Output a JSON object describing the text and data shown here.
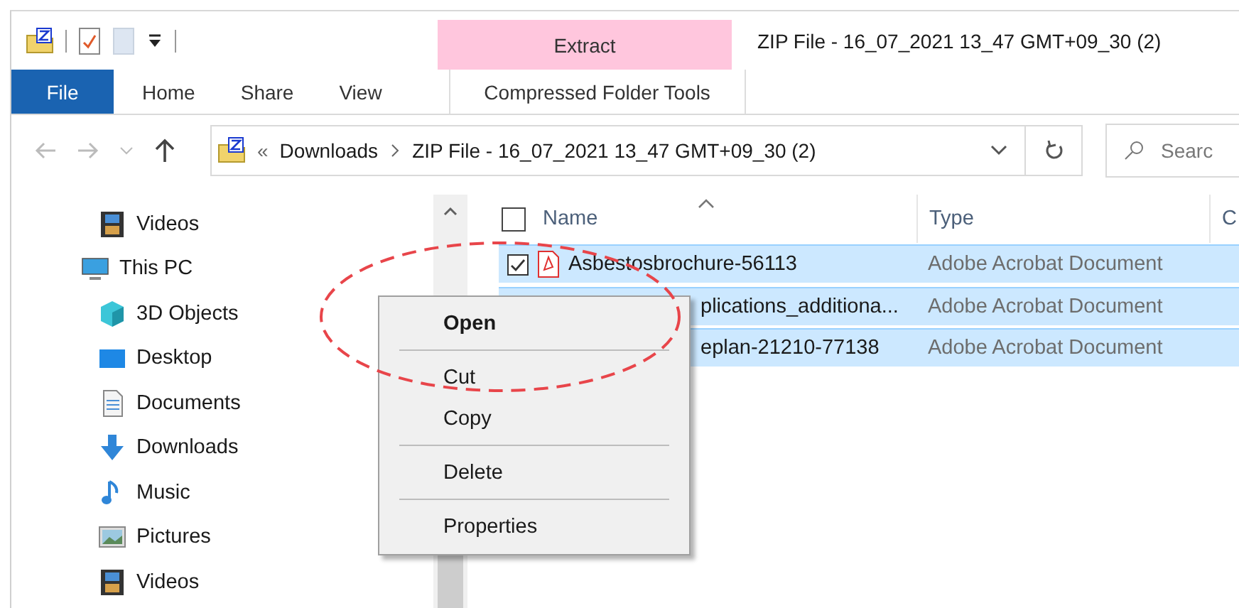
{
  "window": {
    "title": "ZIP File - 16_07_2021 13_47 GMT+09_30 (2)"
  },
  "ribbon": {
    "context_group": "Extract",
    "tabs": [
      {
        "label": "File",
        "kind": "file",
        "selected": false
      },
      {
        "label": "Home",
        "kind": "plain",
        "selected": false
      },
      {
        "label": "Share",
        "kind": "plain",
        "selected": false
      },
      {
        "label": "View",
        "kind": "plain",
        "selected": false
      },
      {
        "label": "Compressed Folder Tools",
        "kind": "contextual",
        "selected": false
      }
    ]
  },
  "address": {
    "overflow": "«",
    "crumbs": [
      "Downloads",
      "ZIP File - 16_07_2021 13_47 GMT+09_30 (2)"
    ]
  },
  "search": {
    "placeholder": "Searc"
  },
  "nav": {
    "items": [
      {
        "label": "Videos",
        "kind": "videos"
      },
      {
        "label": "This PC",
        "kind": "pc",
        "children": [
          {
            "label": "3D Objects",
            "kind": "objects"
          },
          {
            "label": "Desktop",
            "kind": "desktop"
          },
          {
            "label": "Documents",
            "kind": "documents"
          },
          {
            "label": "Downloads",
            "kind": "downloads"
          },
          {
            "label": "Music",
            "kind": "music"
          },
          {
            "label": "Pictures",
            "kind": "pictures"
          },
          {
            "label": "Videos",
            "kind": "videos"
          }
        ]
      }
    ]
  },
  "file_list": {
    "columns": [
      "Name",
      "Type",
      "C"
    ],
    "all_checked": false,
    "rows": [
      {
        "name": "Asbestosbrochure-56113",
        "type": "Adobe Acrobat Document",
        "selected": true,
        "checked": true,
        "covered": false
      },
      {
        "name": "plications_additiona...",
        "type": "Adobe Acrobat Document",
        "selected": true,
        "covered": true
      },
      {
        "name": "eplan-21210-77138",
        "type": "Adobe Acrobat Document",
        "selected": true,
        "covered": true
      }
    ]
  },
  "context_menu": {
    "items": [
      {
        "kind": "item",
        "label": "Open",
        "default": true
      },
      {
        "kind": "separator"
      },
      {
        "kind": "item",
        "label": "Cut",
        "default": false
      },
      {
        "kind": "item",
        "label": "Copy",
        "default": false
      },
      {
        "kind": "separator"
      },
      {
        "kind": "item",
        "label": "Delete",
        "default": false
      },
      {
        "kind": "separator"
      },
      {
        "kind": "item",
        "label": "Properties",
        "default": false
      }
    ]
  }
}
